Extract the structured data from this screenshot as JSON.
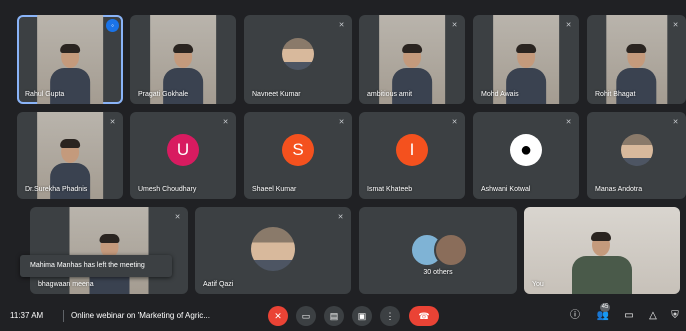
{
  "participants": [
    {
      "name": "Rahul Gupta",
      "kind": "video",
      "active": true
    },
    {
      "name": "Pragati Gokhale",
      "kind": "video"
    },
    {
      "name": "Navneet Kumar",
      "kind": "photo"
    },
    {
      "name": "ambitious amit",
      "kind": "video"
    },
    {
      "name": "Mohd Awais",
      "kind": "video"
    },
    {
      "name": "Rohit Bhagat",
      "kind": "video"
    },
    {
      "name": "Dr.Surekha Phadnis",
      "kind": "video"
    },
    {
      "name": "Umesh Choudhary",
      "kind": "initial",
      "initial": "U",
      "color": "#d81b60"
    },
    {
      "name": "Shaeel Kumar",
      "kind": "initial",
      "initial": "S",
      "color": "#f4511e"
    },
    {
      "name": "Ismat Khateeb",
      "kind": "initial",
      "initial": "I",
      "color": "#f4511e"
    },
    {
      "name": "Ashwani Kotwal",
      "kind": "photo"
    },
    {
      "name": "Manas Andotra",
      "kind": "photo"
    },
    {
      "name": "bhagwaan meena",
      "kind": "video"
    },
    {
      "name": "Aatif Qazi",
      "kind": "photo"
    },
    {
      "name": "30 others",
      "kind": "others"
    },
    {
      "name": "You",
      "kind": "video"
    }
  ],
  "toast": "Mahima Manhas has left the meeting",
  "meeting": {
    "time": "11:37 AM",
    "title": "Online webinar on 'Marketing of Agric...",
    "people_count": "45"
  },
  "icons": {
    "mic_off": "mic-off-icon",
    "camera": "camera-icon",
    "captions": "captions-icon",
    "present": "present-icon",
    "more": "more-vert-icon",
    "end": "call-end-icon",
    "info": "info-icon",
    "people": "people-icon",
    "chat": "chat-icon",
    "activities": "activities-icon",
    "host": "host-controls-icon"
  },
  "colors": {
    "end_call": "#ea4335",
    "active_border": "#8ab4f8"
  }
}
